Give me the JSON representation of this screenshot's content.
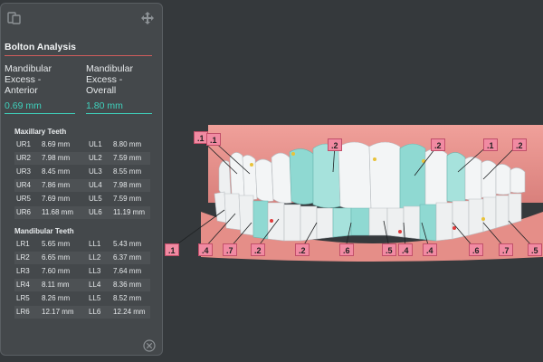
{
  "panel": {
    "title": "Bolton Analysis",
    "excess": [
      {
        "label_lines": [
          "Mandibular",
          "Excess -",
          "Anterior"
        ],
        "value": "0.69 mm"
      },
      {
        "label_lines": [
          "Mandibular",
          "Excess -",
          "Overall"
        ],
        "value": "1.80 mm"
      }
    ],
    "maxillary": {
      "title": "Maxillary Teeth",
      "rows": [
        [
          "UR1",
          "8.69 mm",
          "UL1",
          "8.80 mm"
        ],
        [
          "UR2",
          "7.98 mm",
          "UL2",
          "7.59 mm"
        ],
        [
          "UR3",
          "8.45 mm",
          "UL3",
          "8.55 mm"
        ],
        [
          "UR4",
          "7.86 mm",
          "UL4",
          "7.98 mm"
        ],
        [
          "UR5",
          "7.69 mm",
          "UL5",
          "7.59 mm"
        ],
        [
          "UR6",
          "11.68 mm",
          "UL6",
          "11.19 mm"
        ]
      ]
    },
    "mandibular": {
      "title": "Mandibular Teeth",
      "rows": [
        [
          "LR1",
          "5.65 mm",
          "LL1",
          "5.43 mm"
        ],
        [
          "LR2",
          "6.65 mm",
          "LL2",
          "6.37 mm"
        ],
        [
          "LR3",
          "7.60 mm",
          "LL3",
          "7.64 mm"
        ],
        [
          "LR4",
          "8.11 mm",
          "LL4",
          "8.36 mm"
        ],
        [
          "LR5",
          "8.26 mm",
          "LL5",
          "8.52 mm"
        ],
        [
          "LR6",
          "12.17 mm",
          "LL6",
          "12.24 mm"
        ]
      ]
    },
    "icons": {
      "top_left": "copy-icon",
      "top_right": "move-icon",
      "bottom": "close-icon"
    }
  },
  "model_view": {
    "upper_labels": [
      ".1",
      ".1",
      ".2",
      ".2",
      ".1",
      ".2"
    ],
    "lower_labels": [
      ".1",
      ".4",
      ".7",
      ".2",
      ".2",
      ".6",
      ".5",
      ".4",
      ".4",
      ".6",
      ".7",
      ".5"
    ]
  },
  "colors": {
    "accent": "#3fd2bd",
    "title_underline": "#d05c5c",
    "gum": "#e9938f",
    "tooth": "#f3f5f6",
    "tooth_highlight": "#8fd9d2",
    "label_bg": "#f18aa2",
    "background": "#35393c",
    "panel": "#44484b"
  }
}
